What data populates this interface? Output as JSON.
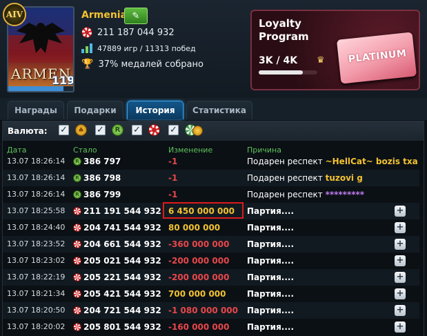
{
  "profile": {
    "rank_badge": "AIV",
    "avatar_text": "ARMEN",
    "level": "119",
    "level_progress": 0.85,
    "name": "Armenia",
    "chips": "211 187 044 932",
    "games": "47889 игр / 11313 побед",
    "medals": "37% медалей собрано"
  },
  "loyalty": {
    "title": "Loyalty Program",
    "progress_text": "3K / 4K",
    "progress": 0.75,
    "tier": "PLATINUM"
  },
  "tabs": [
    {
      "label": "Награды",
      "active": false
    },
    {
      "label": "Подарки",
      "active": false
    },
    {
      "label": "История",
      "active": true
    },
    {
      "label": "Статистика",
      "active": false
    }
  ],
  "filter": {
    "label": "Валюта:"
  },
  "columns": {
    "date": "Дата",
    "balance": "Стало",
    "change": "Изменение",
    "reason": "Причина"
  },
  "rows": [
    {
      "date": "13.07 18:26:14",
      "currency": "green-coin",
      "balance": "386 797",
      "change": "-1",
      "sign": "neg",
      "reason": "Подарен респект",
      "who": "~HellCat~ bozis txa"
    },
    {
      "date": "13.07 18:26:14",
      "currency": "green-coin",
      "balance": "386 798",
      "change": "-1",
      "sign": "neg",
      "reason": "Подарен респект",
      "who": "tuzovi g"
    },
    {
      "date": "13.07 18:26:14",
      "currency": "green-coin",
      "balance": "386 799",
      "change": "-1",
      "sign": "neg",
      "reason": "Подарен респект",
      "who": "*********"
    },
    {
      "date": "13.07 18:25:58",
      "currency": "chip",
      "balance": "211 191 544 932",
      "change": "6 450 000 000",
      "sign": "pos",
      "reason": "Партия....",
      "who": ""
    },
    {
      "date": "13.07 18:24:40",
      "currency": "chip",
      "balance": "204 741 544 932",
      "change": "80 000 000",
      "sign": "pos",
      "reason": "Партия....",
      "who": ""
    },
    {
      "date": "13.07 18:23:52",
      "currency": "chip",
      "balance": "204 661 544 932",
      "change": "-360 000 000",
      "sign": "neg",
      "reason": "Партия....",
      "who": ""
    },
    {
      "date": "13.07 18:23:02",
      "currency": "chip",
      "balance": "205 021 544 932",
      "change": "-200 000 000",
      "sign": "neg",
      "reason": "Партия....",
      "who": ""
    },
    {
      "date": "13.07 18:22:19",
      "currency": "chip",
      "balance": "205 221 544 932",
      "change": "-200 000 000",
      "sign": "neg",
      "reason": "Партия....",
      "who": ""
    },
    {
      "date": "13.07 18:21:34",
      "currency": "chip",
      "balance": "205 421 544 932",
      "change": "700 000 000",
      "sign": "pos",
      "reason": "Партия....",
      "who": ""
    },
    {
      "date": "13.07 18:20:50",
      "currency": "chip",
      "balance": "204 721 544 932",
      "change": "-1 080 000 000",
      "sign": "neg",
      "reason": "Партия....",
      "who": ""
    },
    {
      "date": "13.07 18:20:02",
      "currency": "chip",
      "balance": "205 801 544 932",
      "change": "-160 000 000",
      "sign": "neg",
      "reason": "Партия....",
      "who": ""
    }
  ],
  "colors": {
    "accent_gold": "#f2c230",
    "negative": "#e8474a",
    "active_tab": "#12568b",
    "highlight": "#e01a1a"
  }
}
